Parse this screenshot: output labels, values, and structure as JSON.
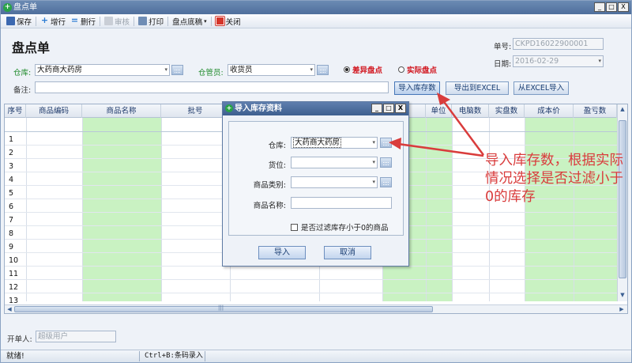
{
  "window": {
    "title": "盘点单",
    "buttons": {
      "min": "_",
      "max": "□",
      "close": "X"
    }
  },
  "toolbar": {
    "save": "保存",
    "add_row": "增行",
    "del_row": "删行",
    "audit": "审核",
    "print": "打印",
    "draft": "盘点底稿",
    "close": "关闭"
  },
  "form": {
    "title": "盘点单",
    "doc_no_label": "单号:",
    "doc_no": "CKPD16022900001",
    "date_label": "日期:",
    "date": "2016-02-29",
    "warehouse_label": "仓库:",
    "warehouse": "大药商大药房",
    "keeper_label": "仓管员:",
    "keeper": "收货员",
    "mode_diff": "差异盘点",
    "mode_actual": "实际盘点",
    "remark_label": "备注:",
    "remark": ""
  },
  "actions": {
    "import_stock": "导入库存数",
    "export_excel": "导出到EXCEL",
    "import_excel": "从EXCEL导入"
  },
  "grid": {
    "columns": [
      "序号",
      "商品编码",
      "商品名称",
      "批号",
      "单位",
      "电脑数",
      "实盘数",
      "成本价",
      "盈亏数"
    ],
    "rows": [
      "1",
      "2",
      "3",
      "4",
      "5",
      "6",
      "7",
      "8",
      "9",
      "10",
      "11",
      "12",
      "13"
    ]
  },
  "footer": {
    "maker_label": "开单人:",
    "maker": "超级用户"
  },
  "status": {
    "left": "就绪!",
    "hint": "Ctrl+B:条码录入"
  },
  "dialog": {
    "title": "导入库存资料",
    "warehouse_label": "仓库:",
    "warehouse": "大药商大药房",
    "location_label": "货位:",
    "location": "",
    "category_label": "商品类别:",
    "category": "",
    "name_label": "商品名称:",
    "name": "",
    "filter_label": "是否过滤库存小于0的商品",
    "ok": "导入",
    "cancel": "取消"
  },
  "annotation": {
    "text": "导入库存数，根据实际情况选择是否过滤小于0的库存"
  },
  "colors": {
    "green_col": "#c9f2c2",
    "accent_red": "#d1141d",
    "annotation_red": "#d93c3c"
  }
}
